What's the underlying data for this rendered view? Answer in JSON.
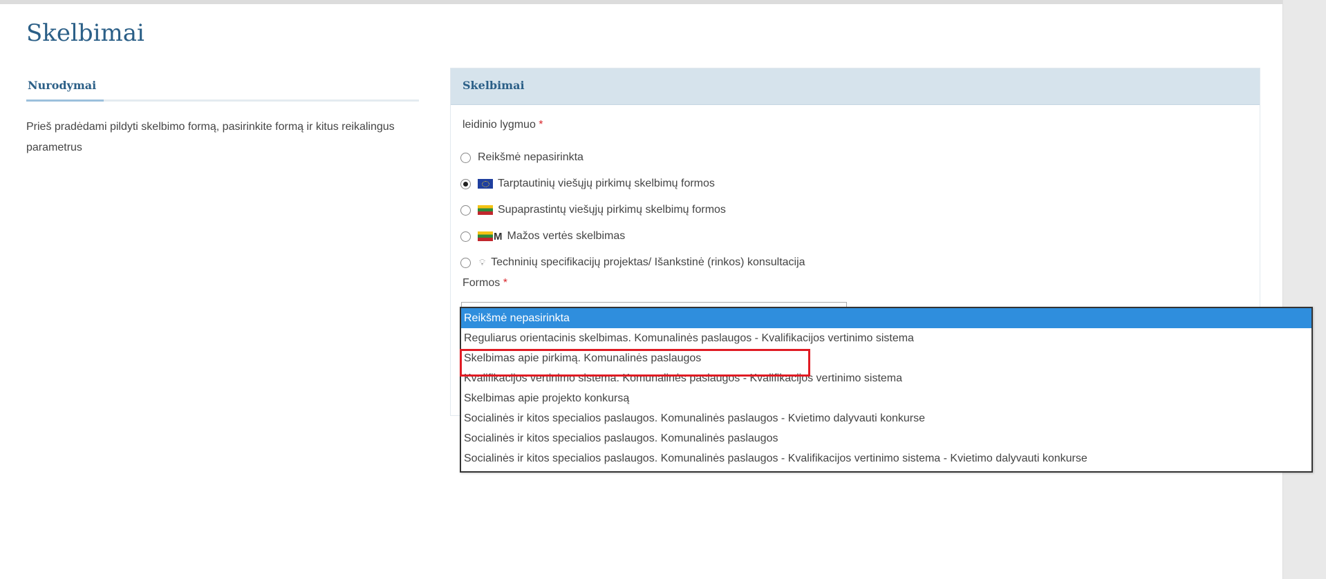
{
  "page": {
    "title": "Skelbimai"
  },
  "instructions": {
    "title": "Nurodymai",
    "text": "Prieš pradėdami pildyti skelbimo formą, pasirinkite formą ir kitus reikalingus parametrus"
  },
  "panel": {
    "title": "Skelbimai",
    "level_label": "leidinio lygmuo",
    "required_mark": "*",
    "radio_options": [
      {
        "label": "Reikšmė nepasirinkta",
        "checked": false,
        "icon": "none"
      },
      {
        "label": "Tarptautinių viešųjų pirkimų skelbimų formos",
        "checked": true,
        "icon": "eu-flag-icon"
      },
      {
        "label": "Supaprastintų viešųjų pirkimų skelbimų formos",
        "checked": false,
        "icon": "lt-flag-icon"
      },
      {
        "label": "Mažos vertės skelbimas",
        "checked": false,
        "icon": "lt-flag-m-icon",
        "icon_text": "M"
      },
      {
        "label": "Techninių specifikacijų projektas/ Išankstinė (rinkos) konsultacija",
        "checked": false,
        "icon": "bulb-icon"
      }
    ],
    "forms_label": "Formos",
    "forms_required_mark": "*"
  },
  "dropdown": {
    "options": [
      "Reikšmė nepasirinkta",
      "Reguliarus orientacinis skelbimas. Komunalinės paslaugos - Kvalifikacijos vertinimo sistema",
      "Skelbimas apie pirkimą. Komunalinės paslaugos",
      "Kvalifikacijos vertinimo sistema. Komunalinės paslaugos - Kvalifikacijos vertinimo sistema",
      "Skelbimas apie projekto konkursą",
      "Socialinės ir kitos specialios paslaugos. Komunalinės paslaugos - Kvietimo dalyvauti konkurse",
      "Socialinės ir kitos specialios paslaugos. Komunalinės paslaugos",
      "Socialinės ir kitos specialios paslaugos. Komunalinės paslaugos - Kvalifikacijos vertinimo sistema - Kvietimo dalyvauti konkurse"
    ],
    "selected_index": 0,
    "highlighted_index": 2
  },
  "colors": {
    "title": "#2b5f87",
    "panel_header": "#d6e3ec",
    "selected_option": "#2f8edd",
    "highlight_border": "#e01b23",
    "required": "#d9262b"
  }
}
